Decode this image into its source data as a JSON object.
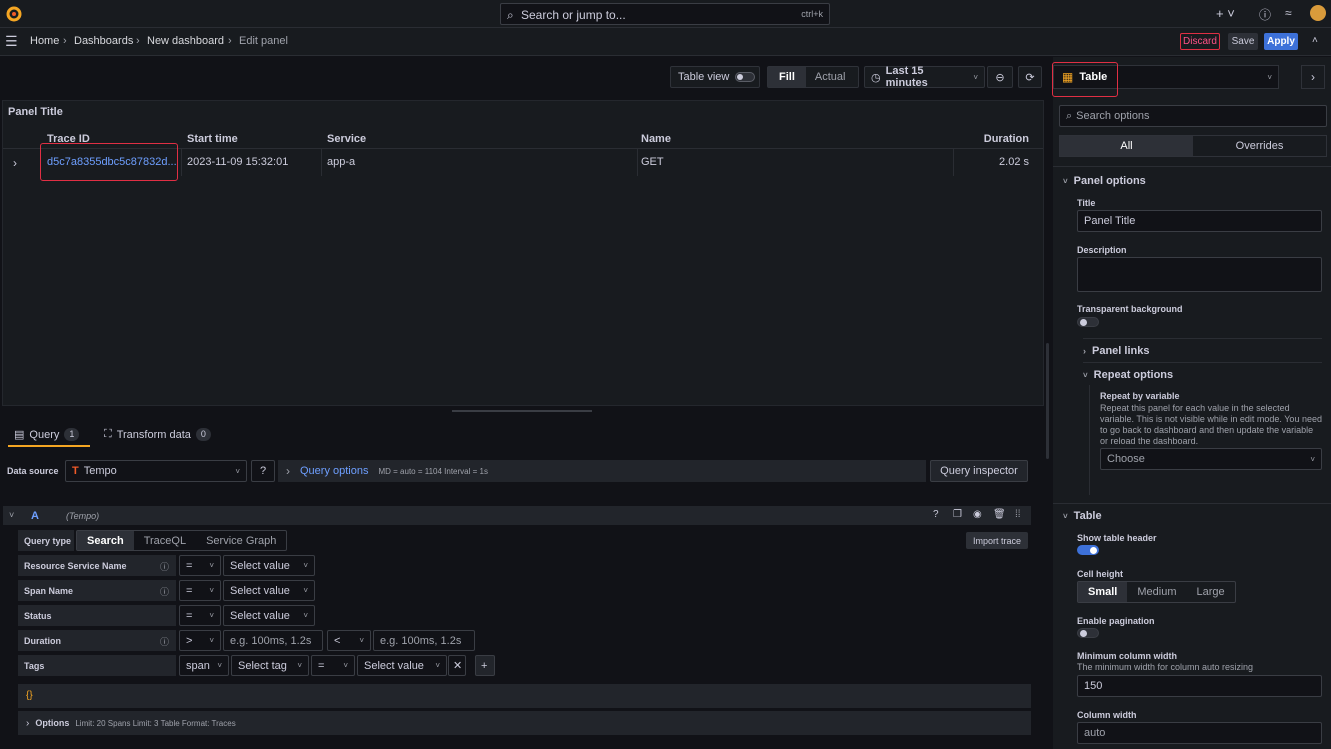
{
  "topbar": {
    "search_placeholder": "Search or jump to...",
    "search_shortcut": "ctrl+k"
  },
  "breadcrumbs": [
    "Home",
    "Dashboards",
    "New dashboard",
    "Edit panel"
  ],
  "nav_actions": {
    "discard": "Discard",
    "save": "Save",
    "apply": "Apply"
  },
  "toolbar": {
    "table_view": "Table view",
    "fill": "Fill",
    "actual": "Actual",
    "time_range": "Last 15 minutes"
  },
  "panel": {
    "title": "Panel Title",
    "columns": [
      "Trace ID",
      "Start time",
      "Service",
      "Name",
      "Duration"
    ],
    "rows": [
      {
        "trace_id": "d5c7a8355dbc5c87832d...",
        "start_time": "2023-11-09 15:32:01",
        "service": "app-a",
        "name": "GET",
        "duration": "2.02 s"
      }
    ]
  },
  "query_tabs": [
    {
      "label": "Query",
      "count": "1"
    },
    {
      "label": "Transform data",
      "count": "0"
    }
  ],
  "datasource": {
    "label": "Data source",
    "value": "Tempo",
    "query_options": "Query options",
    "query_meta": "MD = auto = 1104    Interval = 1s",
    "inspector": "Query inspector"
  },
  "query": {
    "ref": "A",
    "ds_hint": "(Tempo)",
    "type_label": "Query type",
    "types": [
      "Search",
      "TraceQL",
      "Service Graph"
    ],
    "import_trace": "Import trace",
    "rows": [
      {
        "label": "Resource Service Name",
        "op": "=",
        "value": "Select value"
      },
      {
        "label": "Span Name",
        "op": "=",
        "value": "Select value"
      },
      {
        "label": "Status",
        "op": "=",
        "value": "Select value"
      },
      {
        "label": "Duration",
        "op": ">",
        "value": "e.g. 100ms, 1.2s",
        "op2": "<",
        "value2": "e.g. 100ms, 1.2s"
      },
      {
        "label": "Tags",
        "scope": "span",
        "tag": "Select tag",
        "op": "=",
        "value": "Select value"
      }
    ],
    "braces": "{}",
    "options_label": "Options",
    "options_meta": "Limit: 20    Spans Limit: 3    Table Format: Traces"
  },
  "right": {
    "viz": "Table",
    "search_placeholder": "Search options",
    "tabs": [
      "All",
      "Overrides"
    ],
    "panel_options": "Panel options",
    "title_label": "Title",
    "title_value": "Panel Title",
    "description_label": "Description",
    "transparent_label": "Transparent background",
    "panel_links": "Panel links",
    "repeat_options": "Repeat options",
    "repeat_by": "Repeat by variable",
    "repeat_desc": "Repeat this panel for each value in the selected variable. This is not visible while in edit mode. You need to go back to dashboard and then update the variable or reload the dashboard.",
    "choose": "Choose",
    "table_section": "Table",
    "show_header": "Show table header",
    "cell_height": "Cell height",
    "cell_heights": [
      "Small",
      "Medium",
      "Large"
    ],
    "pagination": "Enable pagination",
    "min_width_label": "Minimum column width",
    "min_width_desc": "The minimum width for column auto resizing",
    "min_width_value": "150",
    "col_width_label": "Column width",
    "col_width_value": "auto"
  },
  "colors": {
    "accent": "#3d71d9",
    "link": "#6e9fff",
    "danger": "#e02f44",
    "bg": "#111217",
    "panel": "#181b1f"
  }
}
